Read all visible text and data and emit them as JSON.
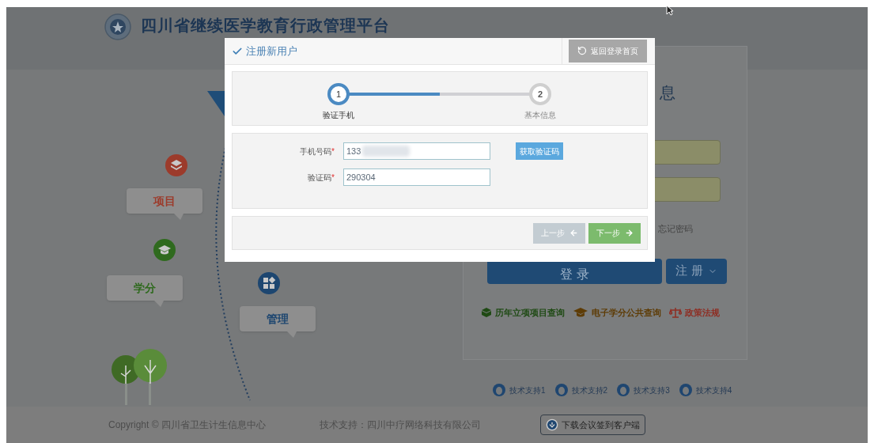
{
  "header": {
    "title": "四川省继续医学教育行政管理平台"
  },
  "illustration": {
    "bubbles": [
      {
        "label": "项目",
        "kind": "layers",
        "color": "#9c3b2b"
      },
      {
        "label": "学分",
        "kind": "cap",
        "color": "#2f6a1e"
      },
      {
        "label": "管理",
        "kind": "grid",
        "color": "#1d4670"
      }
    ]
  },
  "login_panel": {
    "title": "息",
    "forgot_link": "忘记密码",
    "login_button": "登 录",
    "register_button": "注 册",
    "links": [
      {
        "label": "历年立项项目查询",
        "kind": "cube",
        "color": "#1f4a14"
      },
      {
        "label": "电子学分公共查询",
        "kind": "cap",
        "color": "#5e3c06"
      },
      {
        "label": "政策法规",
        "kind": "scale",
        "color": "#8e2f25"
      }
    ]
  },
  "support_links": [
    "技术支持1",
    "技术支持2",
    "技术支持3",
    "技术支持4"
  ],
  "footer": {
    "copyright": "Copyright © 四川省卫生计生信息中心",
    "tech_support": "技术支持：四川中疗网络科技有限公司",
    "download_button": "下载会议签到客户端"
  },
  "modal": {
    "title": "注册新用户",
    "back_button": "返回登录首页",
    "steps": [
      {
        "number": "1",
        "label": "验证手机",
        "selected": true
      },
      {
        "number": "2",
        "label": "基本信息",
        "selected": false
      }
    ],
    "progress": {
      "level": 0.5
    },
    "fields": [
      {
        "label": "手机号码",
        "mark": "*",
        "value": "133",
        "redacted": true
      },
      {
        "label": "验证码",
        "mark": "*",
        "value": "290304",
        "redacted": false
      }
    ],
    "code_button": "获取验证码",
    "buttons": [
      {
        "label": "上一步",
        "kind": "prev",
        "disabled": true
      },
      {
        "label": "下一步",
        "kind": "next",
        "disabled": false
      }
    ]
  }
}
